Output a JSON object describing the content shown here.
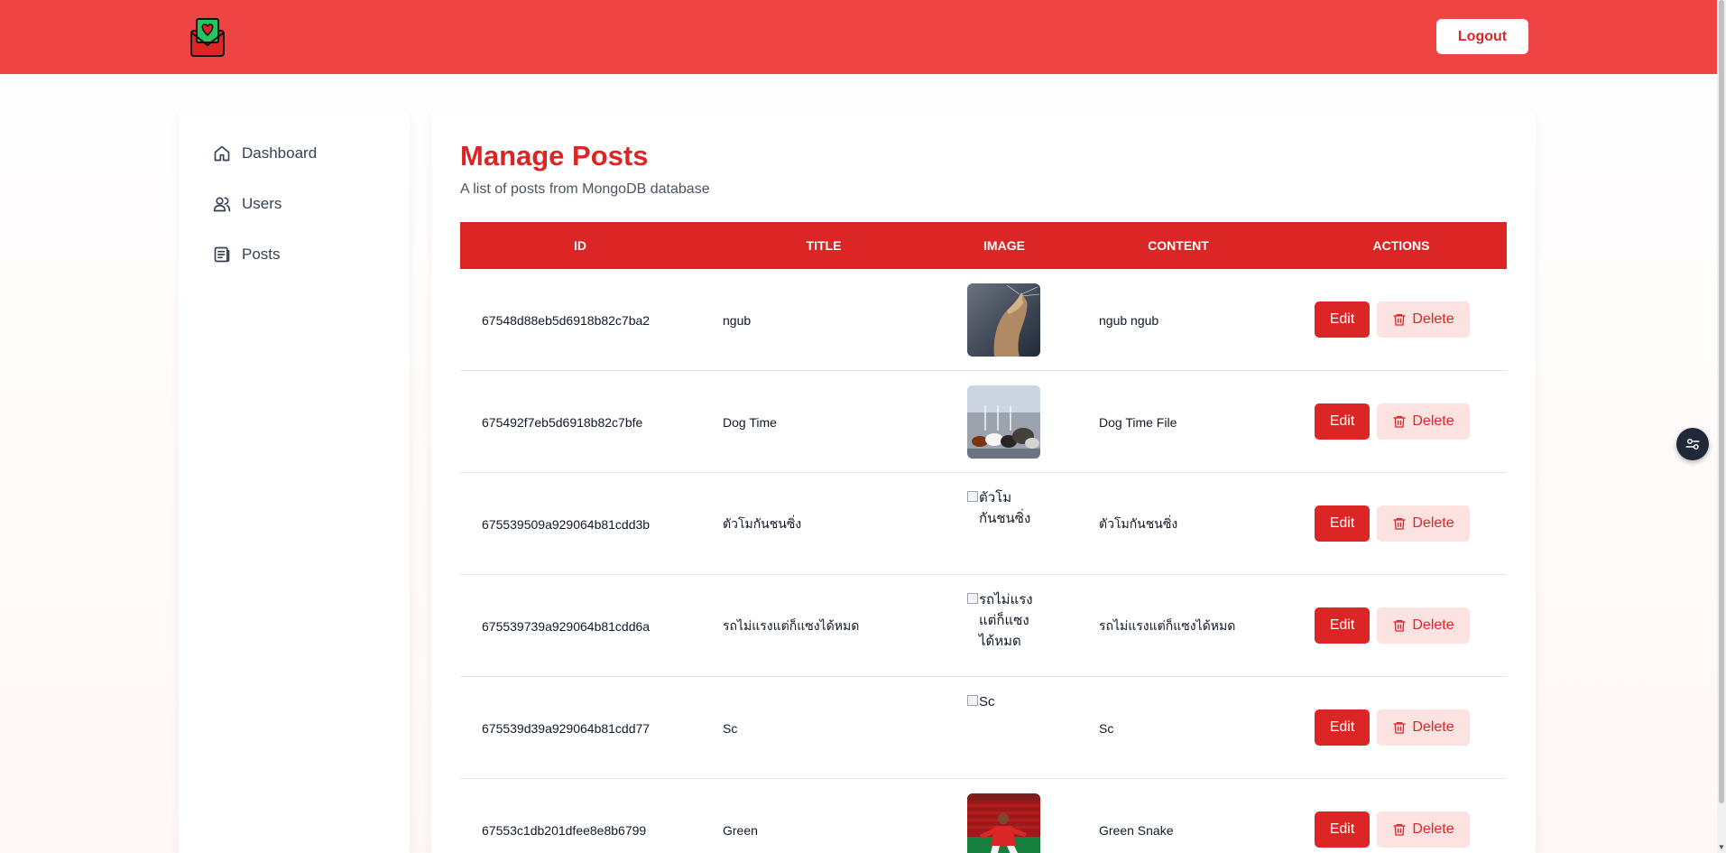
{
  "header": {
    "logout_label": "Logout",
    "brand_color": "#ef4444"
  },
  "sidebar": {
    "items": [
      {
        "label": "Dashboard",
        "icon": "home-icon"
      },
      {
        "label": "Users",
        "icon": "users-icon"
      },
      {
        "label": "Posts",
        "icon": "posts-icon"
      }
    ]
  },
  "main": {
    "title": "Manage Posts",
    "subtitle": "A list of posts from MongoDB database",
    "columns": [
      "ID",
      "TITLE",
      "IMAGE",
      "CONTENT",
      "ACTIONS"
    ],
    "rows": [
      {
        "id": "67548d88eb5d6918b82c7ba2",
        "title": "ngub",
        "image": "cat-photo",
        "image_alt": "",
        "content": "ngub ngub"
      },
      {
        "id": "675492f7eb5d6918b82c7bfe",
        "title": "Dog Time",
        "image": "dogs-photo",
        "image_alt": "",
        "content": "Dog Time File"
      },
      {
        "id": "675539509a929064b81cdd3b",
        "title": "ตัวโมกันชนซิ่ง",
        "image": "broken",
        "image_alt": "ตัวโมกันชนซิ่ง",
        "content": "ตัวโมกันชนซิ่ง"
      },
      {
        "id": "675539739a929064b81cdd6a",
        "title": "รถไม่แรงแต่ก็แซงได้หมด",
        "image": "broken",
        "image_alt": "รถไม่แรงแต่ก็แซงได้หมด",
        "content": "รถไม่แรงแต่ก็แซงได้หมด"
      },
      {
        "id": "675539d39a929064b81cdd77",
        "title": "Sc",
        "image": "broken",
        "image_alt": "Sc",
        "content": "Sc"
      },
      {
        "id": "67553c1db201dfee8e8b6799",
        "title": "Green",
        "image": "football-photo",
        "image_alt": "",
        "content": "Green Snake"
      }
    ],
    "edit_label": "Edit",
    "delete_label": "Delete"
  },
  "colors": {
    "accent": "#dc2626",
    "delete_bg": "#fde2e2"
  }
}
